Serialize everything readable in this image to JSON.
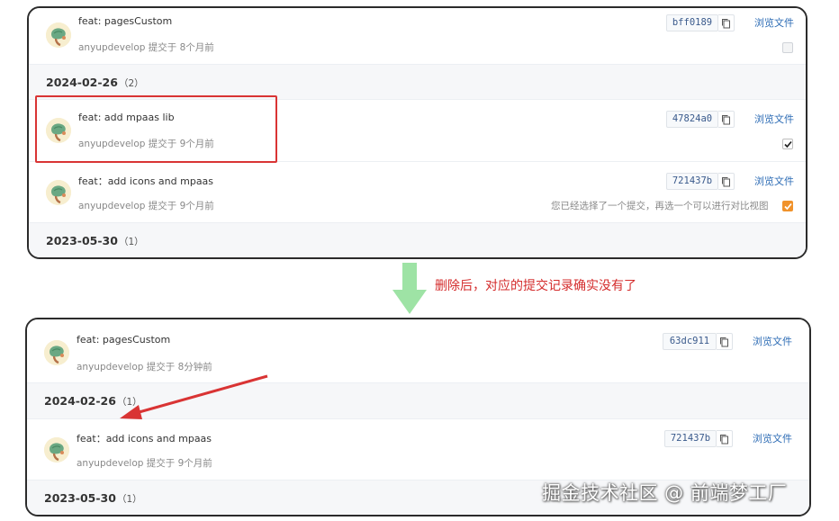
{
  "top_panel": {
    "commit1": {
      "message": "feat: pagesCustom",
      "author": "anyupdevelop",
      "action": "提交于",
      "when": "8个月前",
      "sha": "bff0189",
      "browse": "浏览文件"
    },
    "date1": {
      "date": "2024-02-26",
      "count": "（2）"
    },
    "commit2": {
      "message": "feat: add mpaas lib",
      "author": "anyupdevelop",
      "action": "提交于",
      "when": "9个月前",
      "sha": "47824a0",
      "browse": "浏览文件"
    },
    "commit3": {
      "message": "feat：add icons and mpaas",
      "author": "anyupdevelop",
      "action": "提交于",
      "when": "9个月前",
      "sha": "721437b",
      "browse": "浏览文件",
      "compare_hint": "您已经选择了一个提交，再选一个可以进行对比视图"
    },
    "date2": {
      "date": "2023-05-30",
      "count": "（1）"
    }
  },
  "annotation": "删除后，对应的提交记录确实没有了",
  "bottom_panel": {
    "commit1": {
      "message": "feat: pagesCustom",
      "author": "anyupdevelop",
      "action": "提交于",
      "when": "8分钟前",
      "sha": "63dc911",
      "browse": "浏览文件"
    },
    "date1": {
      "date": "2024-02-26",
      "count": "（1）"
    },
    "commit2": {
      "message": "feat：add icons and mpaas",
      "author": "anyupdevelop",
      "action": "提交于",
      "when": "9个月前",
      "sha": "721437b",
      "browse": "浏览文件"
    },
    "date2": {
      "date": "2023-05-30",
      "count": "（1）"
    }
  },
  "watermark": "掘金技术社区 @ 前端梦工厂",
  "colors": {
    "link": "#2d6cb5",
    "highlight": "#d93434",
    "annotation": "#d42c2c",
    "arrow_green": "#9ee3a5",
    "checkbox_orange": "#f0922b"
  }
}
